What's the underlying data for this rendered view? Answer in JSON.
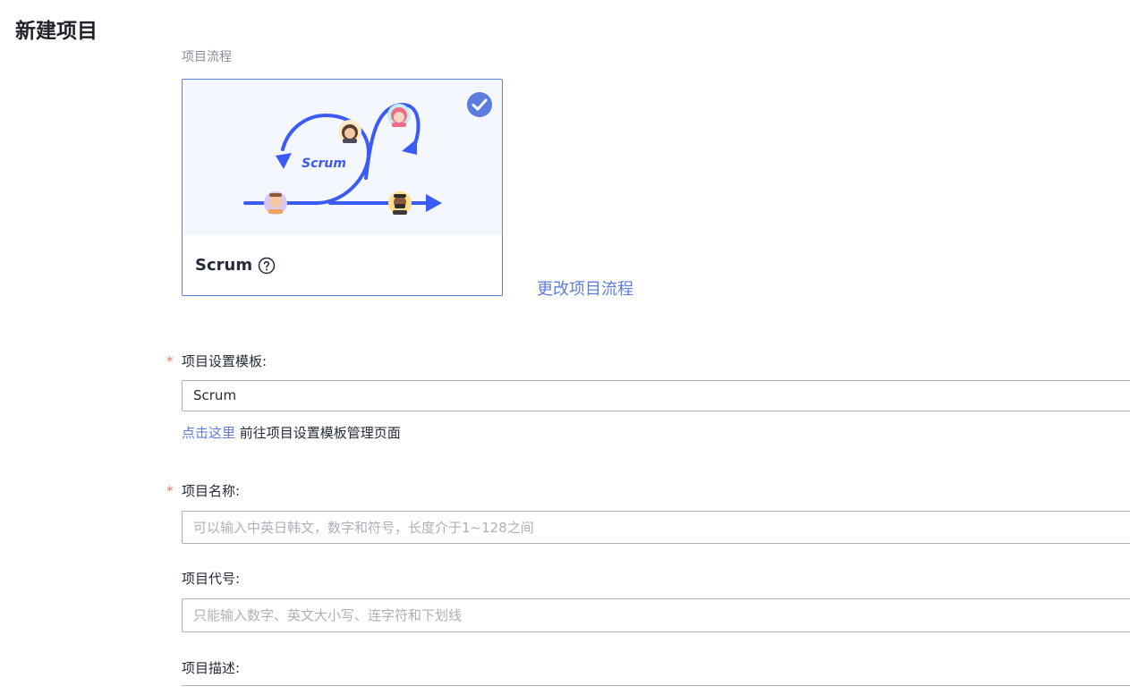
{
  "page": {
    "title": "新建项目"
  },
  "process": {
    "section_label": "项目流程",
    "card": {
      "name": "Scrum",
      "illustration_text": "Scrum",
      "selected": true,
      "help_icon": "question-circle-icon",
      "check_icon": "check-circle-icon"
    },
    "change_link": "更改项目流程"
  },
  "form": {
    "required_mark": "*",
    "template": {
      "label": "项目设置模板:",
      "value": "Scrum",
      "hint_link": "点击这里",
      "hint_text": "前往项目设置模板管理页面"
    },
    "name": {
      "label": "项目名称:",
      "placeholder": "可以输入中英日韩文，数字和符号，长度介于1~128之间"
    },
    "code": {
      "label": "项目代号:",
      "placeholder": "只能输入数字、英文大小写、连字符和下划线"
    },
    "description": {
      "label": "项目描述:"
    }
  },
  "colors": {
    "accent": "#5e7ce0",
    "illustration_arrow": "#3b5bf6",
    "required": "#f66f6a",
    "border": "#adb0b8"
  }
}
